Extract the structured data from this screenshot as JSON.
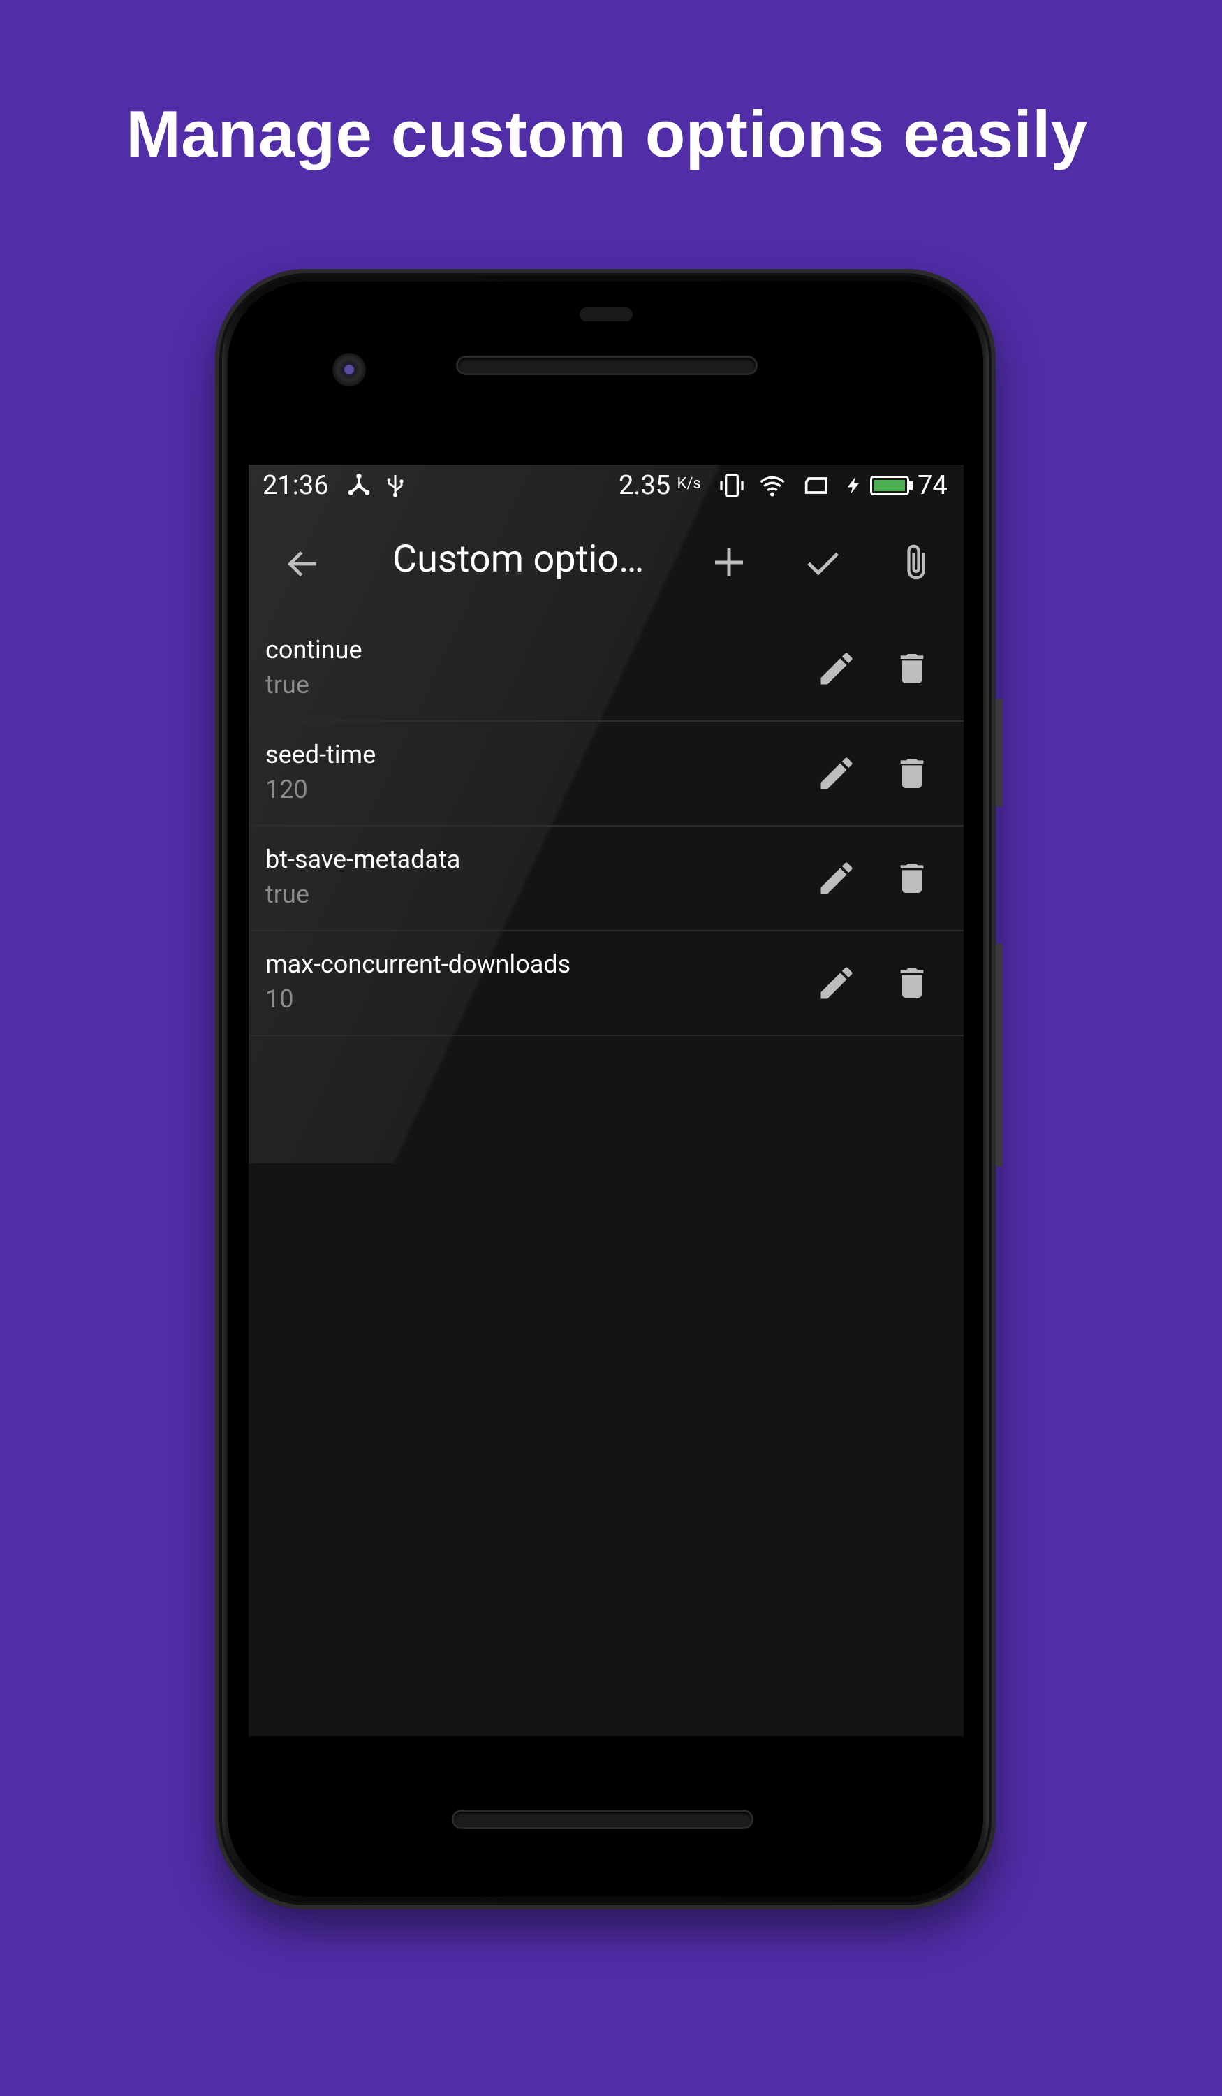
{
  "headline": "Manage custom options easily",
  "status_bar": {
    "time": "21:36",
    "speed": "2.35",
    "speed_unit": "K/s",
    "battery_level": "74",
    "battery_color": "#4caf50",
    "icons": [
      "network-share-icon",
      "usb-icon",
      "vibrate-icon",
      "wifi-icon",
      "cast-icon",
      "charging-icon",
      "battery-icon"
    ]
  },
  "toolbar": {
    "title": "Custom optio…",
    "back_icon": "arrow-back-icon",
    "add_icon": "plus-icon",
    "confirm_icon": "check-icon",
    "attach_icon": "paperclip-icon"
  },
  "options": [
    {
      "key": "continue",
      "value": "true"
    },
    {
      "key": "seed-time",
      "value": "120"
    },
    {
      "key": "bt-save-metadata",
      "value": "true"
    },
    {
      "key": "max-concurrent-downloads",
      "value": "10"
    }
  ],
  "colors": {
    "background": "#512da8",
    "screen": "#141414",
    "secondary_text": "#8a8a8a",
    "icon": "#bdbdbd"
  }
}
